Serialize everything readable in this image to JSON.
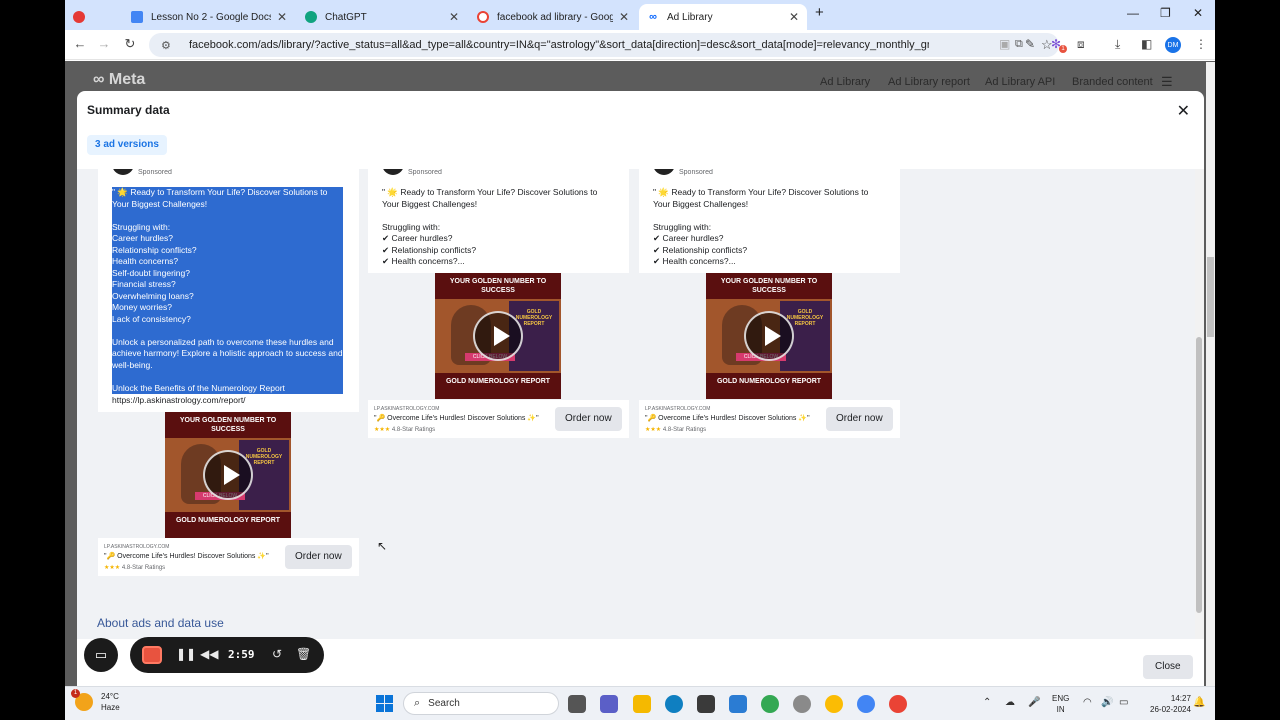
{
  "browser": {
    "tabs": [
      {
        "title": "",
        "icon": "recording-dot-icon",
        "color": "#e53935"
      },
      {
        "title": "Lesson No 2 - Google Docs",
        "icon": "google-docs-icon",
        "color": "#4285f4"
      },
      {
        "title": "ChatGPT",
        "icon": "chatgpt-icon",
        "color": "#10a37f"
      },
      {
        "title": "facebook ad library - Google Se",
        "icon": "google-icon",
        "color": "#ea4335"
      },
      {
        "title": "Ad Library",
        "icon": "meta-icon",
        "color": "#0866ff"
      }
    ],
    "new_tab": "+",
    "url_host": "facebook.com",
    "url_path": "/ads/library/?active_status=all&ad_type=all&country=IN&q=\"astrology\"&sort_data[direction]=desc&sort_data[mode]=relevancy_monthly_grouped&searc...",
    "profile_initials": "DM",
    "extension_badge": "1"
  },
  "meta": {
    "logo": "Meta",
    "nav": [
      "Ad Library",
      "Ad Library report",
      "Ad Library API",
      "Branded content"
    ]
  },
  "modal": {
    "title": "Summary data",
    "versions_badge": "3 ad versions",
    "about_link": "About ads and data use",
    "close_label": "Close"
  },
  "ads": [
    {
      "sponsored": "Sponsored",
      "selected": true,
      "lines": [
        "\" 🌟 Ready to Transform Your Life? Discover Solutions to",
        "Your Biggest Challenges!",
        "",
        "Struggling with:",
        "     Career hurdles?",
        "     Relationship conflicts?",
        "     Health concerns?",
        "     Self-doubt lingering?",
        "     Financial stress?",
        "     Overwhelming loans?",
        "     Money worries?",
        "     Lack of consistency?",
        "",
        "Unlock a personalized path to overcome these hurdles and",
        "achieve harmony! Explore a holistic approach to success and",
        "well-being.",
        "",
        "Unlock the Benefits of the Numerology Report"
      ],
      "url_line": "https://lp.askinastrology.com/report/"
    },
    {
      "sponsored": "Sponsored",
      "selected": false,
      "lines": [
        "\" 🌟 Ready to Transform Your Life? Discover Solutions to",
        "Your Biggest Challenges!",
        "",
        "Struggling with:",
        "✔ Career hurdles?",
        "✔ Relationship conflicts?",
        "✔ Health concerns?..."
      ],
      "url_line": ""
    },
    {
      "sponsored": "Sponsored",
      "selected": false,
      "lines": [
        "\" 🌟 Ready to Transform Your Life? Discover Solutions to",
        "Your Biggest Challenges!",
        "",
        "Struggling with:",
        "✔ Career hurdles?",
        "✔ Relationship conflicts?",
        "✔ Health concerns?..."
      ],
      "url_line": ""
    }
  ],
  "creative": {
    "top": "YOUR GOLDEN NUMBER TO SUCCESS",
    "book": "GOLD NUMEROLOGY REPORT",
    "cta": "CLICK BELOW",
    "bottom": "GOLD NUMEROLOGY REPORT"
  },
  "footer": {
    "domain": "LP.ASKINASTROLOGY.COM",
    "title": "\"🔑 Overcome Life's Hurdles! Discover Solutions ✨\"",
    "stars": "★★★",
    "rating": "4.8-Star Ratings",
    "button": "Order now"
  },
  "recorder": {
    "time": "2:59"
  },
  "taskbar": {
    "temp": "24°C",
    "weather": "Haze",
    "weather_badge": "1",
    "search_placeholder": "Search",
    "lang_top": "ENG",
    "lang_bottom": "IN",
    "time": "14:27",
    "date": "26-02-2024"
  }
}
